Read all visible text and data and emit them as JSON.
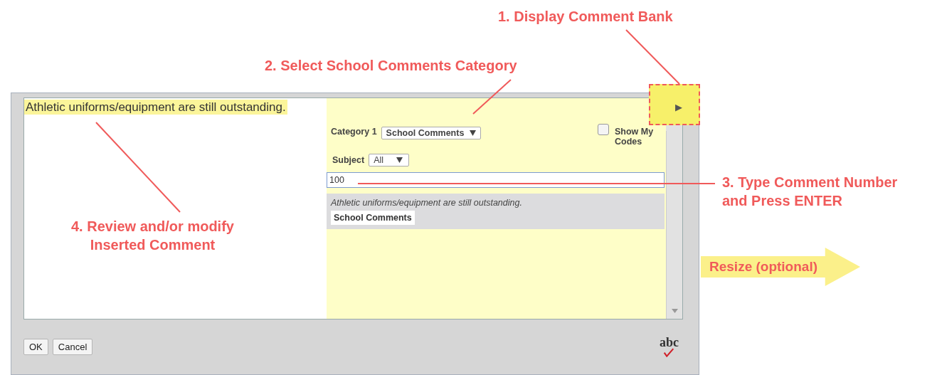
{
  "annotations": [
    {
      "kind": "note",
      "lines": [
        "1. Display Comment Bank"
      ]
    },
    {
      "kind": "note",
      "lines": [
        "2. Select School Comments Category"
      ]
    },
    {
      "kind": "note",
      "lines": [
        "3. Type Comment Number",
        "and Press ENTER"
      ]
    },
    {
      "kind": "note",
      "lines": [
        "4. Review and/or modify",
        "Inserted Comment"
      ]
    },
    {
      "kind": "arrow",
      "lines": [
        "Resize (optional)"
      ]
    }
  ],
  "dialog": {
    "editor": {
      "text": "Athletic uniforms/equipment are still outstanding.",
      "highlighted": true
    },
    "comment_bank": {
      "toggle": "▶",
      "category_label": "Category 1",
      "category_select": "School Comments",
      "show_my_codes": {
        "label": "Show My Codes",
        "checked": false
      },
      "subject_label": "Subject",
      "subject_select": "All",
      "search": {
        "value": "100"
      },
      "results": [
        {
          "text": "Athletic uniforms/equipment are still outstanding.",
          "category": "School Comments"
        }
      ]
    },
    "buttons": [
      "OK",
      "Cancel"
    ],
    "spellcheck": "abc"
  }
}
